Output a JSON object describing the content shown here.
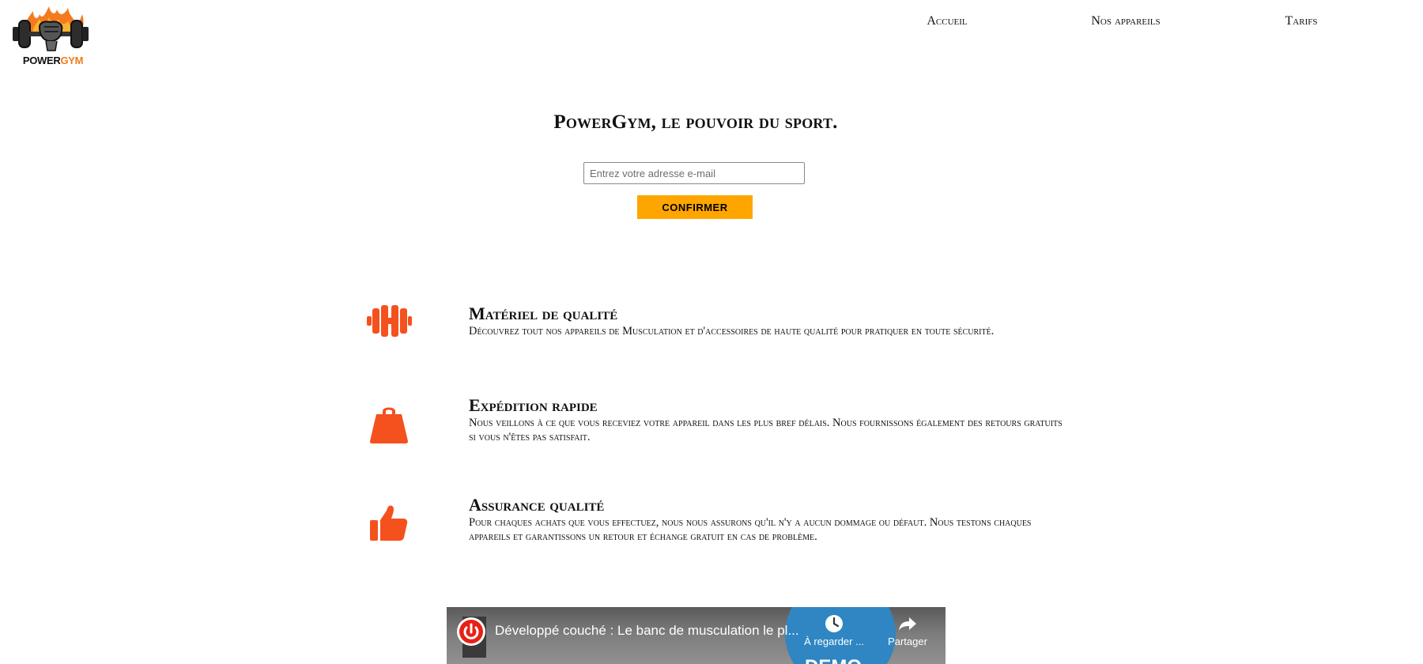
{
  "brand": {
    "logo_word1": "POWER",
    "logo_word2": "GYM",
    "logo_accent": "#f07c1c"
  },
  "nav": {
    "items": [
      "Accueil",
      "Nos appareils",
      "Tarifs"
    ]
  },
  "hero": {
    "title": "PowerGym, le pouvoir du sport.",
    "email_placeholder": "Entrez votre adresse e-mail",
    "email_value": "",
    "confirm_label": "CONFIRMER",
    "confirm_color": "#ffa500"
  },
  "features": [
    {
      "icon": "dumbbell-icon",
      "title": "Matériel de qualité",
      "description": "Découvrez tout nos appareils de Musculation et d'accessoires de haute qualité pour pratiquer en toute sécurité."
    },
    {
      "icon": "weight-icon",
      "title": "Expédition rapide",
      "description": "Nous veillons à ce que vous receviez votre appareil dans les plus bref délais. Nous fournissons également des retours gratuits si vous n'êtes pas satisfait."
    },
    {
      "icon": "thumbs-up-icon",
      "title": "Assurance qualité",
      "description": "Pour chaques achats que vous effectuez, nous nous assurons qu'il n'y a aucun dommage ou défaut. Nous testons chaques appareils et garantissons un retour et échange gratuit en cas de problème."
    }
  ],
  "icon_color": "#f4511e",
  "video": {
    "title": "Développé couché : Le banc de musculation le pl...",
    "watch_later_label": "À regarder ...",
    "share_label": "Partager",
    "overlay_text": "DEMO"
  }
}
